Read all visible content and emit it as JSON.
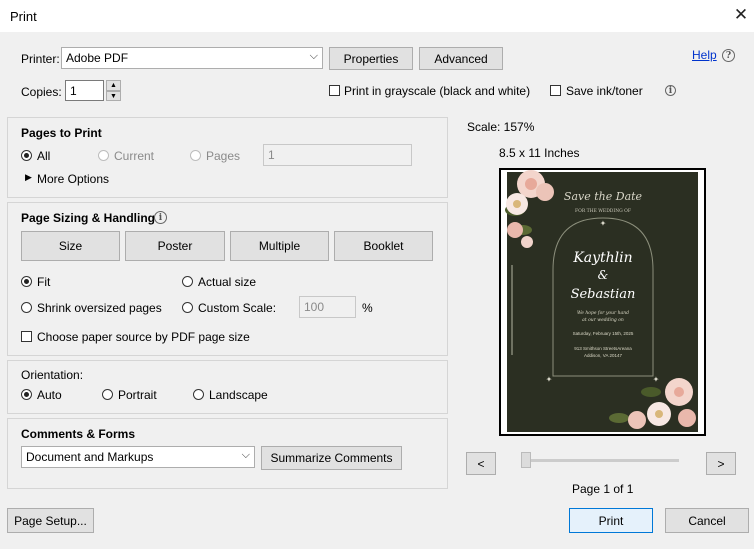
{
  "window": {
    "title": "Print"
  },
  "header": {
    "printer_label": "Printer:",
    "printer_value": "Adobe PDF",
    "properties_label": "Properties",
    "advanced_label": "Advanced",
    "help_label": "Help",
    "copies_label": "Copies:",
    "copies_value": "1",
    "grayscale_label": "Print in grayscale (black and white)",
    "save_ink_label": "Save ink/toner"
  },
  "pages_to_print": {
    "title": "Pages to Print",
    "all_label": "All",
    "current_label": "Current",
    "pages_label": "Pages",
    "pages_value": "1",
    "more_options_label": "More Options"
  },
  "sizing": {
    "title": "Page Sizing & Handling",
    "buttons": [
      "Size",
      "Poster",
      "Multiple",
      "Booklet"
    ],
    "fit_label": "Fit",
    "actual_size_label": "Actual size",
    "shrink_label": "Shrink oversized pages",
    "custom_scale_label": "Custom Scale:",
    "custom_scale_value": "100",
    "percent": "%",
    "choose_source_label": "Choose paper source by PDF page size"
  },
  "orientation": {
    "title": "Orientation:",
    "auto_label": "Auto",
    "portrait_label": "Portrait",
    "landscape_label": "Landscape"
  },
  "comments": {
    "title": "Comments & Forms",
    "select_value": "Document and Markups",
    "summarize_label": "Summarize Comments"
  },
  "preview": {
    "scale": "Scale: 157%",
    "paper_size": "8.5 x 11 Inches",
    "prev": "<",
    "next": ">",
    "page_info": "Page 1 of 1",
    "card": {
      "heading": "Save the Date",
      "subheading": "FOR THE WEDDING OF",
      "name1": "Kaythlin",
      "amp": "&",
      "name2": "Sebastian",
      "invite1": "We hope for your hand",
      "invite2": "at our wedding on",
      "date": "Saturday, February 15th, 2025",
      "address1": "913 Smithson StreetsAreana",
      "address2": "Addison, VA 20147",
      "bg_color": "#2b2f22"
    }
  },
  "footer": {
    "page_setup_label": "Page Setup...",
    "print_label": "Print",
    "cancel_label": "Cancel"
  },
  "colors": {
    "accent": "#0078d7",
    "link": "#0033cc"
  }
}
